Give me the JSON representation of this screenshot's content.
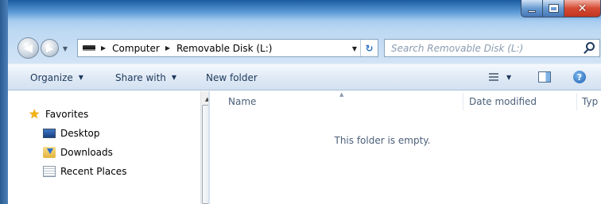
{
  "window": {
    "caption_buttons": {
      "minimize_icon": "minimize-icon",
      "maximize_icon": "maximize-icon",
      "close_glyph": "✕"
    }
  },
  "address_bar": {
    "breadcrumbs": [
      "Computer",
      "Removable Disk (L:)"
    ],
    "separator": "▶",
    "dropdown_glyph": "▼",
    "refresh_glyph": "↻"
  },
  "search": {
    "placeholder": "Search Removable Disk (L:)"
  },
  "toolbar": {
    "organize_label": "Organize",
    "share_label": "Share with",
    "new_folder_label": "New folder",
    "caret": "▼",
    "help_glyph": "?"
  },
  "nav_pane": {
    "favorites_label": "Favorites",
    "items": [
      {
        "label": "Desktop",
        "icon": "desktop-icon"
      },
      {
        "label": "Downloads",
        "icon": "downloads-icon"
      },
      {
        "label": "Recent Places",
        "icon": "recent-places-icon"
      }
    ]
  },
  "content": {
    "columns": [
      "Name",
      "Date modified",
      "Typ"
    ],
    "empty_message": "This folder is empty."
  },
  "colors": {
    "title_bar": "#5b9ad6",
    "toolbar": "#dfe9f5",
    "text": "#1e395b",
    "close_button": "#d44a33"
  }
}
